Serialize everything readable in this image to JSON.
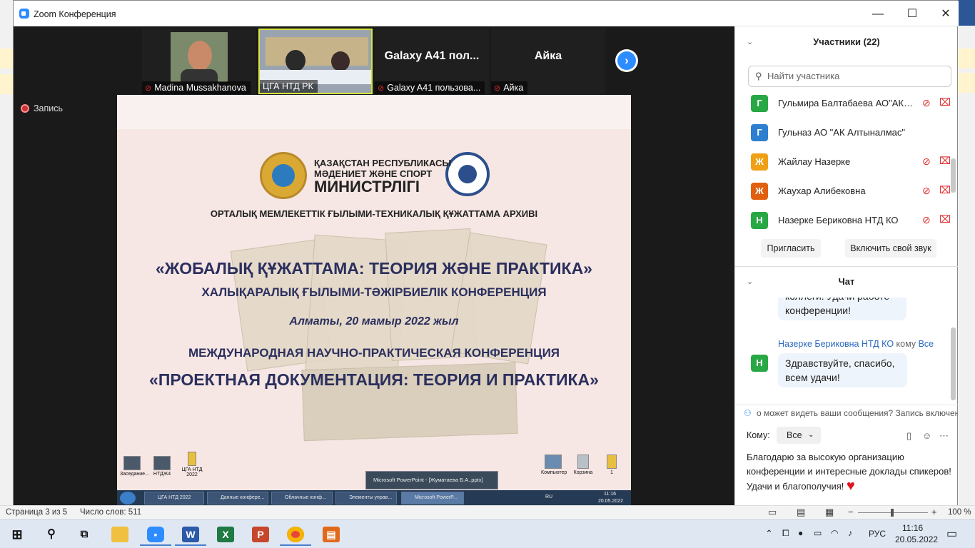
{
  "window": {
    "title": "Zoom Конференция",
    "minimize": "—",
    "maximize": "☐",
    "close": "✕"
  },
  "video_strip": {
    "tiles": [
      {
        "name": "Madina Mussakhanova",
        "muted": true
      },
      {
        "name": "ЦГА НТД РК",
        "muted": false
      },
      {
        "name": "Galaxy A41 пользова...",
        "big": "Galaxy A41 пол...",
        "muted": true
      },
      {
        "name": "Айка",
        "big": "Айка",
        "muted": true
      }
    ],
    "next_arrow": "›"
  },
  "recording": {
    "label": "Запись"
  },
  "slide": {
    "ministry_line1": "ҚАЗАҚСТАН РЕСПУБЛИКАСЫ",
    "ministry_line2": "МӘДЕНИЕТ ЖӘНЕ СПОРТ",
    "ministry_line3": "МИНИСТРЛІГІ",
    "archive": "ОРТАЛЫҚ МЕМЛЕКЕТТІК ҒЫЛЫМИ-ТЕХНИКАЛЫҚ ҚҰЖАТТАМА АРХИВІ",
    "title_kz": "«ЖОБАЛЫҚ ҚҰЖАТТАМА: ТЕОРИЯ ЖӘНЕ ПРАКТИКА»",
    "subtitle_kz": "ХАЛЫҚАРАЛЫҚ ҒЫЛЫМИ-ТӘЖІРБИЕЛІК КОНФЕРЕНЦИЯ",
    "date": "Алматы, 20 мамыр 2022 жыл",
    "subtitle_ru": "МЕЖДУНАРОДНАЯ НАУЧНО-ПРАКТИЧЕСКАЯ КОНФЕРЕНЦИЯ",
    "title_ru": "«ПРОЕКТНАЯ ДОКУМЕНТАЦИЯ: ТЕОРИЯ И ПРАКТИКА»",
    "remote_desktop": {
      "icons_left": [
        "Заседание...",
        "НТДЖ4",
        "ЦГА НТД 2022"
      ],
      "icons_right": [
        "Компьютер",
        "Корзина",
        "1"
      ],
      "popup": "Microsoft PowerPoint - [Жуматаева Б.А..pptx]",
      "tasks": [
        "ЦГА НТД 2022",
        "Данные конфере...",
        "Облачные конф...",
        "Элементы управ...",
        "Microsoft PowerP..."
      ],
      "lang": "RU",
      "time": "11:16",
      "date": "20.05.2022"
    }
  },
  "participants": {
    "header": "Участники (22)",
    "search_placeholder": "Найти участника",
    "list": [
      {
        "initial": "Г",
        "name": "Гульмира Балтабаева АО\"АКАЛТЫНАЛМАС\"",
        "color": "#28a745"
      },
      {
        "initial": "Г",
        "name": "Гульназ АО \"АК Алтыналмас\"",
        "color": "#2d7fd0"
      },
      {
        "initial": "Ж",
        "name": "Жайлау Назерке",
        "color": "#f0a015"
      },
      {
        "initial": "Ж",
        "name": "Жаухар Алибековна",
        "color": "#e06010"
      },
      {
        "initial": "Н",
        "name": "Назерке Бериковна НТД КО",
        "color": "#28a745"
      }
    ],
    "invite": "Пригласить",
    "unmute": "Включить свой звук"
  },
  "chat": {
    "header": "Чат",
    "prev_message": "коллеги! Удачи работе конференции!",
    "sender": "Назерке Бериковна НТД КО",
    "to_word": "кому",
    "to_target": "Все",
    "sender_initial": "Н",
    "message": "Здравствуйте, спасибо, всем удачи!",
    "privacy_note": "о может видеть ваши сообщения? Запись включена",
    "to_label": "Кому:",
    "to_select": "Все",
    "draft": "Благодарю за высокую организацию конференции и интересные доклады спикеров! Удачи и благополучия!"
  },
  "word_status": {
    "page": "Страница 3 из 5",
    "words": "Число слов: 511",
    "zoom": "100 %"
  },
  "taskbar": {
    "lang": "РУС",
    "time": "11:16",
    "date": "20.05.2022"
  }
}
